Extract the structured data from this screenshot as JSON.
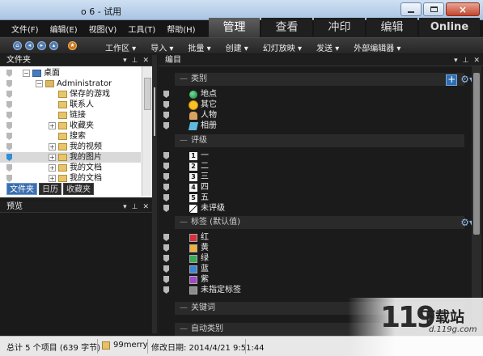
{
  "window": {
    "title": "o 6 - 试用",
    "controls": [
      "minimize",
      "maximize",
      "close"
    ]
  },
  "menu": [
    "文件(F)",
    "编辑(E)",
    "视图(V)",
    "工具(T)",
    "帮助(H)"
  ],
  "modes": [
    "管理",
    "查看",
    "冲印",
    "编辑",
    "Online"
  ],
  "active_mode": "管理",
  "toolbar": [
    "工作区 ▾",
    "导入 ▾",
    "批量 ▾",
    "创建 ▾",
    "幻灯放映 ▾",
    "发送 ▾",
    "外部编辑器 ▾"
  ],
  "folders_panel": {
    "title": "文件夹",
    "tree": [
      {
        "label": "桌面",
        "expander": "−",
        "icon": "desktop"
      },
      {
        "label": "Administrator",
        "expander": "−",
        "icon": "user-folder"
      },
      {
        "label": "保存的游戏",
        "expander": "",
        "icon": "folder"
      },
      {
        "label": "联系人",
        "expander": "",
        "icon": "folder"
      },
      {
        "label": "链接",
        "expander": "",
        "icon": "folder"
      },
      {
        "label": "收藏夹",
        "expander": "+",
        "icon": "folder"
      },
      {
        "label": "搜索",
        "expander": "",
        "icon": "folder"
      },
      {
        "label": "我的视频",
        "expander": "+",
        "icon": "folder"
      },
      {
        "label": "我的图片",
        "expander": "+",
        "icon": "folder",
        "selected": true
      },
      {
        "label": "我的文档",
        "expander": "+",
        "icon": "folder"
      },
      {
        "label": "我的文档",
        "expander": "+",
        "icon": "folder"
      }
    ],
    "tabs": [
      "文件夹",
      "日历",
      "收藏夹"
    ],
    "active_tab": "文件夹"
  },
  "preview_panel": {
    "title": "预览"
  },
  "editor_panel": {
    "title": "编目",
    "sections": [
      {
        "title": "类别",
        "items": [
          {
            "label": "地点",
            "icon": "globe-icon"
          },
          {
            "label": "其它",
            "icon": "sun-icon"
          },
          {
            "label": "人物",
            "icon": "people-icon"
          },
          {
            "label": "相册",
            "icon": "album-icon"
          }
        ]
      },
      {
        "title": "评级",
        "items": [
          {
            "label": "一",
            "rating": "1"
          },
          {
            "label": "二",
            "rating": "2"
          },
          {
            "label": "三",
            "rating": "3"
          },
          {
            "label": "四",
            "rating": "4"
          },
          {
            "label": "五",
            "rating": "5"
          },
          {
            "label": "未评级",
            "rating": ""
          }
        ]
      },
      {
        "title": "标签 (默认值)",
        "items": [
          {
            "label": "红",
            "color": "#d8303a"
          },
          {
            "label": "黄",
            "color": "#f0b03a"
          },
          {
            "label": "绿",
            "color": "#3aa85a"
          },
          {
            "label": "蓝",
            "color": "#3a86d8"
          },
          {
            "label": "紫",
            "color": "#a04ac8"
          },
          {
            "label": "未指定标签",
            "color": "#8c8c8c"
          }
        ]
      },
      {
        "title": "关键词",
        "items": []
      },
      {
        "title": "自动类别",
        "items": []
      }
    ]
  },
  "status": {
    "summary": "总计 5 个项目 (639 字节)",
    "folder": "99merry",
    "modified": "修改日期: 2014/4/21 9:51:44"
  },
  "watermark": {
    "brand": "下载站",
    "url": "d.119g.com",
    "logo": "119"
  }
}
